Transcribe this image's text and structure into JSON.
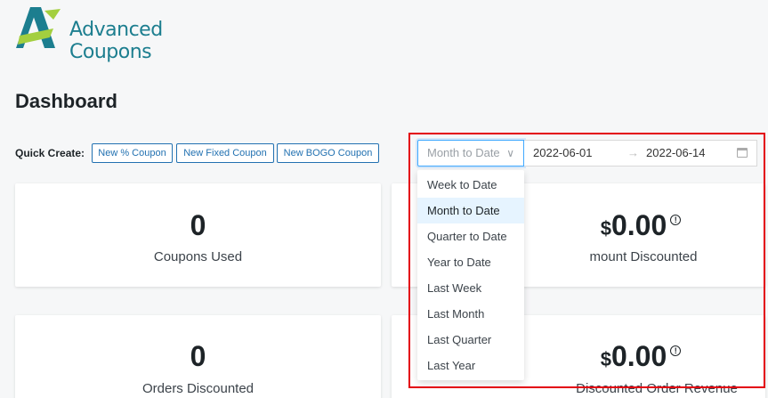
{
  "brand": {
    "name": "Advanced Coupons",
    "color": "#1c7e8f",
    "accent": "#a3cf3f"
  },
  "page": {
    "title": "Dashboard"
  },
  "quick_create": {
    "label": "Quick Create:",
    "buttons": [
      "New % Coupon",
      "New Fixed Coupon",
      "New BOGO Coupon"
    ]
  },
  "date_range": {
    "selected": "Month to Date",
    "start": "2022-06-01",
    "end": "2022-06-14",
    "separator": "→",
    "options": [
      "Week to Date",
      "Month to Date",
      "Quarter to Date",
      "Year to Date",
      "Last Week",
      "Last Month",
      "Last Quarter",
      "Last Year"
    ],
    "active_index": 1
  },
  "cards": {
    "coupons_used": {
      "value": "0",
      "caption": "Coupons Used"
    },
    "amount_discounted": {
      "currency": "$",
      "value": "0.00",
      "caption": "mount Discounted"
    },
    "orders_discounted": {
      "value": "0",
      "caption": "Orders Discounted"
    },
    "order_revenue": {
      "currency": "$",
      "value": "0.00",
      "caption": "Discounted Order Revenue"
    }
  },
  "icons": {
    "info": "info-icon",
    "calendar": "calendar-icon",
    "chevron": "chevron-down-icon"
  }
}
